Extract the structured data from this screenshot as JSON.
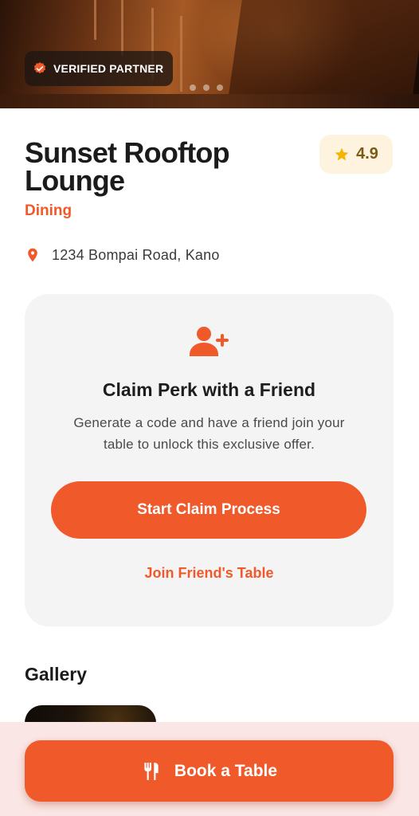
{
  "hero": {
    "badge_label": "VERIFIED PARTNER",
    "badge_icon": "verified-badge-icon",
    "carousel_dots": 3
  },
  "venue": {
    "name": "Sunset Rooftop Lounge",
    "rating": "4.9",
    "category": "Dining",
    "address": "1234 Bompai Road, Kano"
  },
  "perk": {
    "icon": "add-friend-icon",
    "title": "Claim Perk with a Friend",
    "description": "Generate a code and have a friend join your table to unlock this exclusive offer.",
    "primary_button": "Start Claim Process",
    "secondary_link": "Join Friend's Table"
  },
  "gallery": {
    "title": "Gallery"
  },
  "footer": {
    "book_button": "Book a Table",
    "book_icon": "fork-knife-icon"
  },
  "colors": {
    "accent": "#f05a2b",
    "rating_bg": "#fdf3de",
    "card_bg": "#f4f4f4",
    "footer_bg": "#fbe6e6"
  }
}
